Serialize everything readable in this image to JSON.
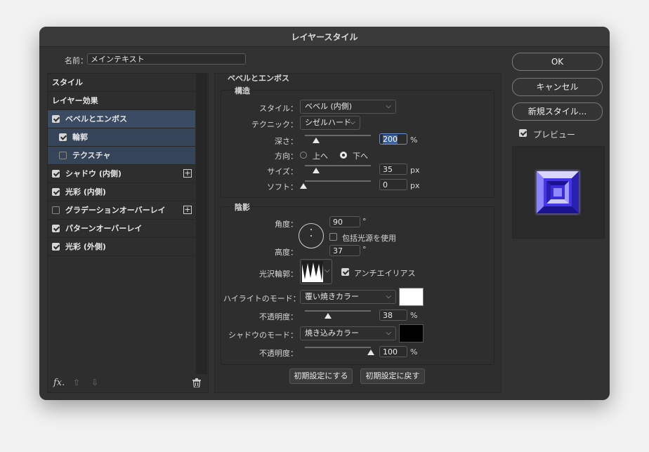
{
  "window": {
    "title": "レイヤースタイル"
  },
  "name_field": {
    "label": "名前：",
    "value": "メインテキスト"
  },
  "left_list": {
    "items": [
      {
        "label": "スタイル"
      },
      {
        "label": "レイヤー効果"
      },
      {
        "label": "ベベルとエンボス"
      },
      {
        "label": "輪郭"
      },
      {
        "label": "テクスチャ"
      },
      {
        "label": "シャドウ (内側)"
      },
      {
        "label": "光彩 (内側)"
      },
      {
        "label": "グラデーションオーバーレイ"
      },
      {
        "label": "パターンオーバーレイ"
      },
      {
        "label": "光彩 (外側)"
      }
    ],
    "fx_label": "fx."
  },
  "bevel": {
    "section_title": "ベベルとエンボス",
    "structure_title": "構造",
    "style_label": "スタイル：",
    "style_value": "ベベル (内側)",
    "technique_label": "テクニック：",
    "technique_value": "シゼルハード",
    "depth_label": "深さ：",
    "depth_value": "200",
    "depth_unit": "%",
    "direction_label": "方向：",
    "dir_up": "上へ",
    "dir_down": "下へ",
    "size_label": "サイズ：",
    "size_value": "35",
    "size_unit": "px",
    "soften_label": "ソフト：",
    "soften_value": "0",
    "soften_unit": "px"
  },
  "shading": {
    "title": "陰影",
    "angle_label": "角度：",
    "angle_value": "90",
    "degree": "°",
    "global_light_label": "包括光源を使用",
    "altitude_label": "高度：",
    "altitude_value": "37",
    "gloss_label": "光沢輪郭：",
    "antialias_label": "アンチエイリアス",
    "highlight_mode_label": "ハイライトのモード：",
    "highlight_mode_value": "覆い焼きカラー",
    "highlight_color": "#ffffff",
    "highlight_opacity_label": "不透明度：",
    "highlight_opacity_value": "38",
    "shadow_mode_label": "シャドウのモード：",
    "shadow_mode_value": "焼き込みカラー",
    "shadow_color": "#000000",
    "shadow_opacity_label": "不透明度：",
    "shadow_opacity_value": "100",
    "percent": "%"
  },
  "bottom_buttons": {
    "make_default": "初期設定にする",
    "reset_default": "初期設定に戻す"
  },
  "right": {
    "ok": "OK",
    "cancel": "キャンセル",
    "new_style": "新規スタイル...",
    "preview_label": "プレビュー"
  }
}
